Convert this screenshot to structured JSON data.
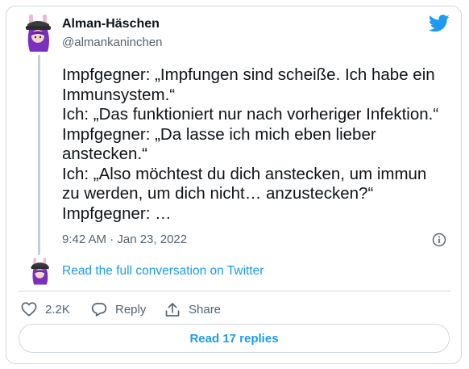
{
  "author": {
    "name": "Alman-Häschen",
    "handle": "@almankaninchen"
  },
  "tweet": {
    "lines": [
      "Impfgegner: „Impfungen sind scheiße. Ich habe ein",
      "Immunsystem.“",
      "Ich: „Das funktioniert nur nach vorheriger Infektion.“",
      "Impfgegner: „Da lasse ich mich eben lieber",
      "anstecken.“",
      "Ich: „Also möchtest du dich anstecken, um immun",
      "zu werden, um dich nicht… anzustecken?“",
      "Impfgegner: …"
    ],
    "timestamp": "9:42 AM · Jan 23, 2022"
  },
  "conversation_link": "Read the full conversation on Twitter",
  "actions": {
    "likes": "2.2K",
    "reply_label": "Reply",
    "share_label": "Share"
  },
  "read_replies_label": "Read 17 replies",
  "colors": {
    "accent": "#1d9bf0",
    "text": "#0f1419",
    "muted": "#536471",
    "border": "#cfd9de",
    "avatar_purple": "#7b2fbe"
  },
  "icons": [
    "twitter-bird-icon",
    "info-icon",
    "heart-icon",
    "reply-bubble-icon",
    "share-icon"
  ]
}
